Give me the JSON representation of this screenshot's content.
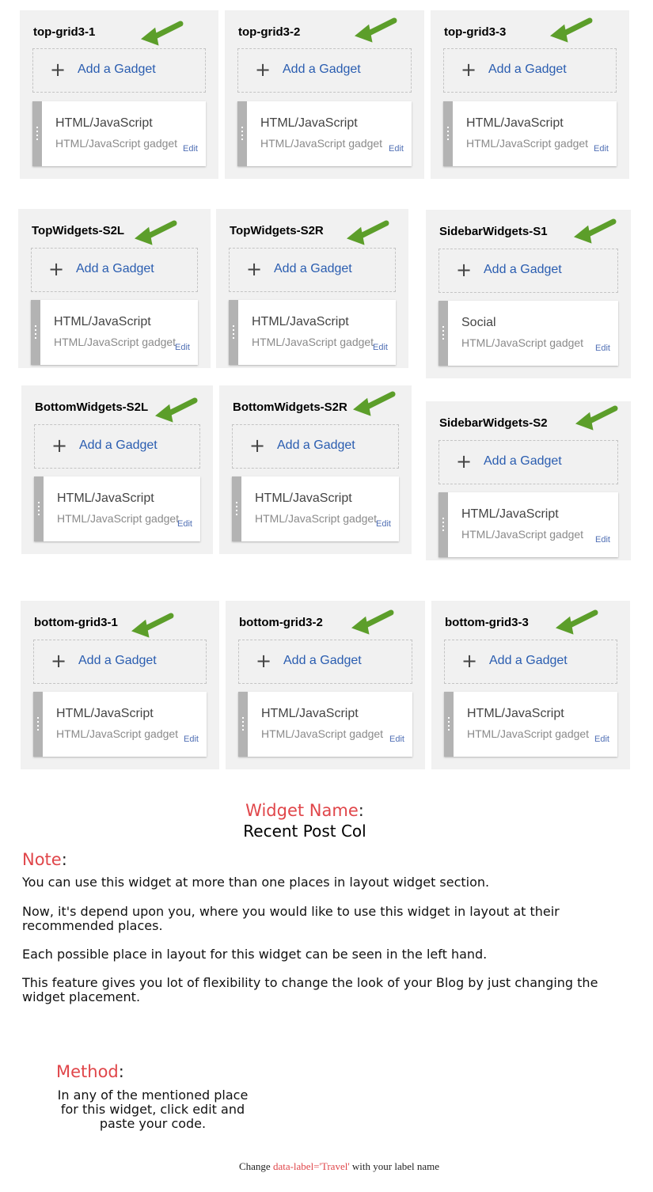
{
  "panels": [
    {
      "id": "top-grid3-1",
      "title": "top-grid3-1",
      "add_label": "Add a Gadget",
      "gadget_title": "HTML/JavaScript",
      "gadget_sub": "HTML/JavaScript gadget",
      "edit_label": "Edit"
    },
    {
      "id": "top-grid3-2",
      "title": "top-grid3-2",
      "add_label": "Add a Gadget",
      "gadget_title": "HTML/JavaScript",
      "gadget_sub": "HTML/JavaScript gadget",
      "edit_label": "Edit"
    },
    {
      "id": "top-grid3-3",
      "title": "top-grid3-3",
      "add_label": "Add a Gadget",
      "gadget_title": "HTML/JavaScript",
      "gadget_sub": "HTML/JavaScript gadget",
      "edit_label": "Edit"
    },
    {
      "id": "topwidgets-s2l",
      "title": "TopWidgets-S2L",
      "add_label": "Add a Gadget",
      "gadget_title": "HTML/JavaScript",
      "gadget_sub": "HTML/JavaScript gadget",
      "edit_label": "Edit"
    },
    {
      "id": "topwidgets-s2r",
      "title": "TopWidgets-S2R",
      "add_label": "Add a Gadget",
      "gadget_title": "HTML/JavaScript",
      "gadget_sub": "HTML/JavaScript gadget",
      "edit_label": "Edit"
    },
    {
      "id": "sidebarwidgets-s1",
      "title": "SidebarWidgets-S1",
      "add_label": "Add a Gadget",
      "gadget_title": "Social",
      "gadget_sub": "HTML/JavaScript gadget",
      "edit_label": "Edit"
    },
    {
      "id": "bottomwidgets-s2l",
      "title": "BottomWidgets-S2L",
      "add_label": "Add a Gadget",
      "gadget_title": "HTML/JavaScript",
      "gadget_sub": "HTML/JavaScript gadget",
      "edit_label": "Edit"
    },
    {
      "id": "bottomwidgets-s2r",
      "title": "BottomWidgets-S2R",
      "add_label": "Add a Gadget",
      "gadget_title": "HTML/JavaScript",
      "gadget_sub": "HTML/JavaScript gadget",
      "edit_label": "Edit"
    },
    {
      "id": "sidebarwidgets-s2",
      "title": "SidebarWidgets-S2",
      "add_label": "Add a Gadget",
      "gadget_title": "HTML/JavaScript",
      "gadget_sub": "HTML/JavaScript gadget",
      "edit_label": "Edit"
    },
    {
      "id": "bottom-grid3-1",
      "title": "bottom-grid3-1",
      "add_label": "Add a Gadget",
      "gadget_title": "HTML/JavaScript",
      "gadget_sub": "HTML/JavaScript gadget",
      "edit_label": "Edit"
    },
    {
      "id": "bottom-grid3-2",
      "title": "bottom-grid3-2",
      "add_label": "Add a Gadget",
      "gadget_title": "HTML/JavaScript",
      "gadget_sub": "HTML/JavaScript gadget",
      "edit_label": "Edit"
    },
    {
      "id": "bottom-grid3-3",
      "title": "bottom-grid3-3",
      "add_label": "Add a Gadget",
      "gadget_title": "HTML/JavaScript",
      "gadget_sub": "HTML/JavaScript gadget",
      "edit_label": "Edit"
    }
  ],
  "icons": {
    "add": "plus-icon",
    "arrow": "green-arrow-icon",
    "grip": "drag-handle-icon"
  },
  "colors": {
    "panel_bg": "#f1f1f1",
    "accent_link": "#2a5db0",
    "arrow_green": "#5c9e2a",
    "heading_red": "#e0464a",
    "grip": "#b3b3b3"
  },
  "info": {
    "widget_name_label": "Widget Name",
    "widget_name_colon": ":",
    "widget_name_value": "Recent Post Col",
    "note_label": "Note",
    "note_colon": ":",
    "note_paragraphs": [
      "You can use this widget at more than one places in layout widget section.",
      "Now, it's depend upon you, where you would like to use this widget in layout at their recommended places.",
      "Each possible place in layout for this widget can be seen in the left hand.",
      "This feature gives you lot of flexibility to change the look of your Blog by just changing the widget placement."
    ],
    "method_label": "Method",
    "method_colon": ":",
    "method_text": "In any of the mentioned place for this widget, click edit and paste your code.",
    "change_prefix": "Change ",
    "change_code": "data-label='Travel'",
    "change_suffix": " with your label name"
  }
}
